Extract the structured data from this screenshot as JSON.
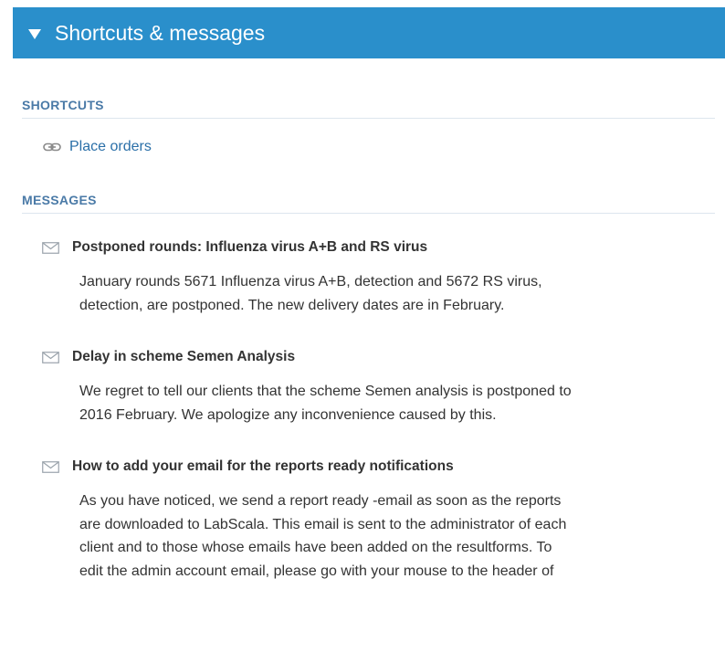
{
  "panel": {
    "title": "Shortcuts & messages"
  },
  "shortcuts": {
    "heading": "SHORTCUTS",
    "items": [
      {
        "label": "Place orders",
        "icon": "link-icon"
      }
    ]
  },
  "messages": {
    "heading": "MESSAGES",
    "items": [
      {
        "title": "Postponed rounds: Influenza virus A+B and RS virus",
        "lines": [
          "January rounds 5671 Influenza virus A+B, detection and 5672 RS virus,",
          "detection, are postponed. The new delivery dates are in February."
        ]
      },
      {
        "title": "Delay in scheme Semen Analysis",
        "lines": [
          "We regret to tell our clients that the scheme Semen analysis is postponed to",
          "2016 February. We apologize any inconvenience caused by this."
        ]
      },
      {
        "title": "How to add your email for the reports ready notifications",
        "lines": [
          "As you have noticed, we send a report ready -email as soon as the reports",
          "are downloaded to LabScala. This email is sent to the administrator of each",
          "client and to those whose emails have been added on the resultforms. To",
          "edit the admin account email, please go with your mouse to the header of"
        ]
      }
    ]
  },
  "colors": {
    "header_bg": "#2a8fcb",
    "section_title": "#4a7aa7",
    "link": "#2a6fa8"
  }
}
